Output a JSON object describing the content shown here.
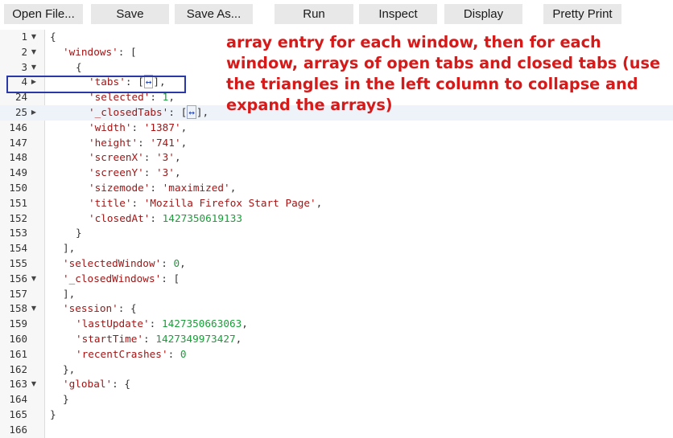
{
  "toolbar": {
    "open_label": "Open File...",
    "save_label": "Save",
    "saveas_label": "Save As...",
    "run_label": "Run",
    "inspect_label": "Inspect",
    "display_label": "Display",
    "pretty_label": "Pretty Print"
  },
  "annotation": {
    "text": "array entry for each window, then for each window, arrays of open tabs and closed tabs (use the triangles in the left column to collapse and expand the arrays)"
  },
  "editor": {
    "lines": [
      {
        "num": "1",
        "fold": "down",
        "indent": 0,
        "tokens": [
          {
            "t": "p",
            "v": "{"
          }
        ]
      },
      {
        "num": "2",
        "fold": "down",
        "indent": 1,
        "tokens": [
          {
            "t": "k",
            "v": "'windows'"
          },
          {
            "t": "p",
            "v": ": ["
          }
        ]
      },
      {
        "num": "3",
        "fold": "down",
        "indent": 2,
        "tokens": [
          {
            "t": "p",
            "v": "{"
          }
        ]
      },
      {
        "num": "4",
        "fold": "right",
        "indent": 3,
        "tokens": [
          {
            "t": "k",
            "v": "'tabs'"
          },
          {
            "t": "p",
            "v": ": ["
          },
          {
            "t": "c",
            "v": "↔"
          },
          {
            "t": "p",
            "v": "],"
          }
        ]
      },
      {
        "num": "24",
        "fold": "",
        "indent": 3,
        "tokens": [
          {
            "t": "k",
            "v": "'selected'"
          },
          {
            "t": "p",
            "v": ": "
          },
          {
            "t": "n",
            "v": "1"
          },
          {
            "t": "p",
            "v": ","
          }
        ]
      },
      {
        "num": "25",
        "fold": "right",
        "indent": 3,
        "highlight": true,
        "tokens": [
          {
            "t": "k",
            "v": "'_closedTabs'"
          },
          {
            "t": "p",
            "v": ": ["
          },
          {
            "t": "c",
            "v": "↔"
          },
          {
            "t": "p",
            "v": "],"
          }
        ]
      },
      {
        "num": "146",
        "fold": "",
        "indent": 3,
        "tokens": [
          {
            "t": "k",
            "v": "'width'"
          },
          {
            "t": "p",
            "v": ": "
          },
          {
            "t": "s",
            "v": "'1387'"
          },
          {
            "t": "p",
            "v": ","
          }
        ]
      },
      {
        "num": "147",
        "fold": "",
        "indent": 3,
        "tokens": [
          {
            "t": "k",
            "v": "'height'"
          },
          {
            "t": "p",
            "v": ": "
          },
          {
            "t": "s",
            "v": "'741'"
          },
          {
            "t": "p",
            "v": ","
          }
        ]
      },
      {
        "num": "148",
        "fold": "",
        "indent": 3,
        "tokens": [
          {
            "t": "k",
            "v": "'screenX'"
          },
          {
            "t": "p",
            "v": ": "
          },
          {
            "t": "s",
            "v": "'3'"
          },
          {
            "t": "p",
            "v": ","
          }
        ]
      },
      {
        "num": "149",
        "fold": "",
        "indent": 3,
        "tokens": [
          {
            "t": "k",
            "v": "'screenY'"
          },
          {
            "t": "p",
            "v": ": "
          },
          {
            "t": "s",
            "v": "'3'"
          },
          {
            "t": "p",
            "v": ","
          }
        ]
      },
      {
        "num": "150",
        "fold": "",
        "indent": 3,
        "tokens": [
          {
            "t": "k",
            "v": "'sizemode'"
          },
          {
            "t": "p",
            "v": ": "
          },
          {
            "t": "s",
            "v": "'maximized'"
          },
          {
            "t": "p",
            "v": ","
          }
        ]
      },
      {
        "num": "151",
        "fold": "",
        "indent": 3,
        "tokens": [
          {
            "t": "k",
            "v": "'title'"
          },
          {
            "t": "p",
            "v": ": "
          },
          {
            "t": "s",
            "v": "'Mozilla Firefox Start Page'"
          },
          {
            "t": "p",
            "v": ","
          }
        ]
      },
      {
        "num": "152",
        "fold": "",
        "indent": 3,
        "tokens": [
          {
            "t": "k",
            "v": "'closedAt'"
          },
          {
            "t": "p",
            "v": ": "
          },
          {
            "t": "n",
            "v": "1427350619133"
          }
        ]
      },
      {
        "num": "153",
        "fold": "",
        "indent": 2,
        "tokens": [
          {
            "t": "p",
            "v": "}"
          }
        ]
      },
      {
        "num": "154",
        "fold": "",
        "indent": 1,
        "tokens": [
          {
            "t": "p",
            "v": "],"
          }
        ]
      },
      {
        "num": "155",
        "fold": "",
        "indent": 1,
        "tokens": [
          {
            "t": "k",
            "v": "'selectedWindow'"
          },
          {
            "t": "p",
            "v": ": "
          },
          {
            "t": "n",
            "v": "0"
          },
          {
            "t": "p",
            "v": ","
          }
        ]
      },
      {
        "num": "156",
        "fold": "down",
        "indent": 1,
        "tokens": [
          {
            "t": "k",
            "v": "'_closedWindows'"
          },
          {
            "t": "p",
            "v": ": ["
          }
        ]
      },
      {
        "num": "157",
        "fold": "",
        "indent": 1,
        "tokens": [
          {
            "t": "p",
            "v": "],"
          }
        ]
      },
      {
        "num": "158",
        "fold": "down",
        "indent": 1,
        "tokens": [
          {
            "t": "k",
            "v": "'session'"
          },
          {
            "t": "p",
            "v": ": {"
          }
        ]
      },
      {
        "num": "159",
        "fold": "",
        "indent": 2,
        "tokens": [
          {
            "t": "k",
            "v": "'lastUpdate'"
          },
          {
            "t": "p",
            "v": ": "
          },
          {
            "t": "n",
            "v": "1427350663063"
          },
          {
            "t": "p",
            "v": ","
          }
        ]
      },
      {
        "num": "160",
        "fold": "",
        "indent": 2,
        "tokens": [
          {
            "t": "k",
            "v": "'startTime'"
          },
          {
            "t": "p",
            "v": ": "
          },
          {
            "t": "n",
            "v": "1427349973427"
          },
          {
            "t": "p",
            "v": ","
          }
        ]
      },
      {
        "num": "161",
        "fold": "",
        "indent": 2,
        "tokens": [
          {
            "t": "k",
            "v": "'recentCrashes'"
          },
          {
            "t": "p",
            "v": ": "
          },
          {
            "t": "n",
            "v": "0"
          }
        ]
      },
      {
        "num": "162",
        "fold": "",
        "indent": 1,
        "tokens": [
          {
            "t": "p",
            "v": "},"
          }
        ]
      },
      {
        "num": "163",
        "fold": "down",
        "indent": 1,
        "tokens": [
          {
            "t": "k",
            "v": "'global'"
          },
          {
            "t": "p",
            "v": ": {"
          }
        ]
      },
      {
        "num": "164",
        "fold": "",
        "indent": 1,
        "tokens": [
          {
            "t": "p",
            "v": "}"
          }
        ]
      },
      {
        "num": "165",
        "fold": "",
        "indent": 0,
        "tokens": [
          {
            "t": "p",
            "v": "}"
          }
        ]
      },
      {
        "num": "166",
        "fold": "",
        "indent": 0,
        "tokens": []
      }
    ]
  }
}
